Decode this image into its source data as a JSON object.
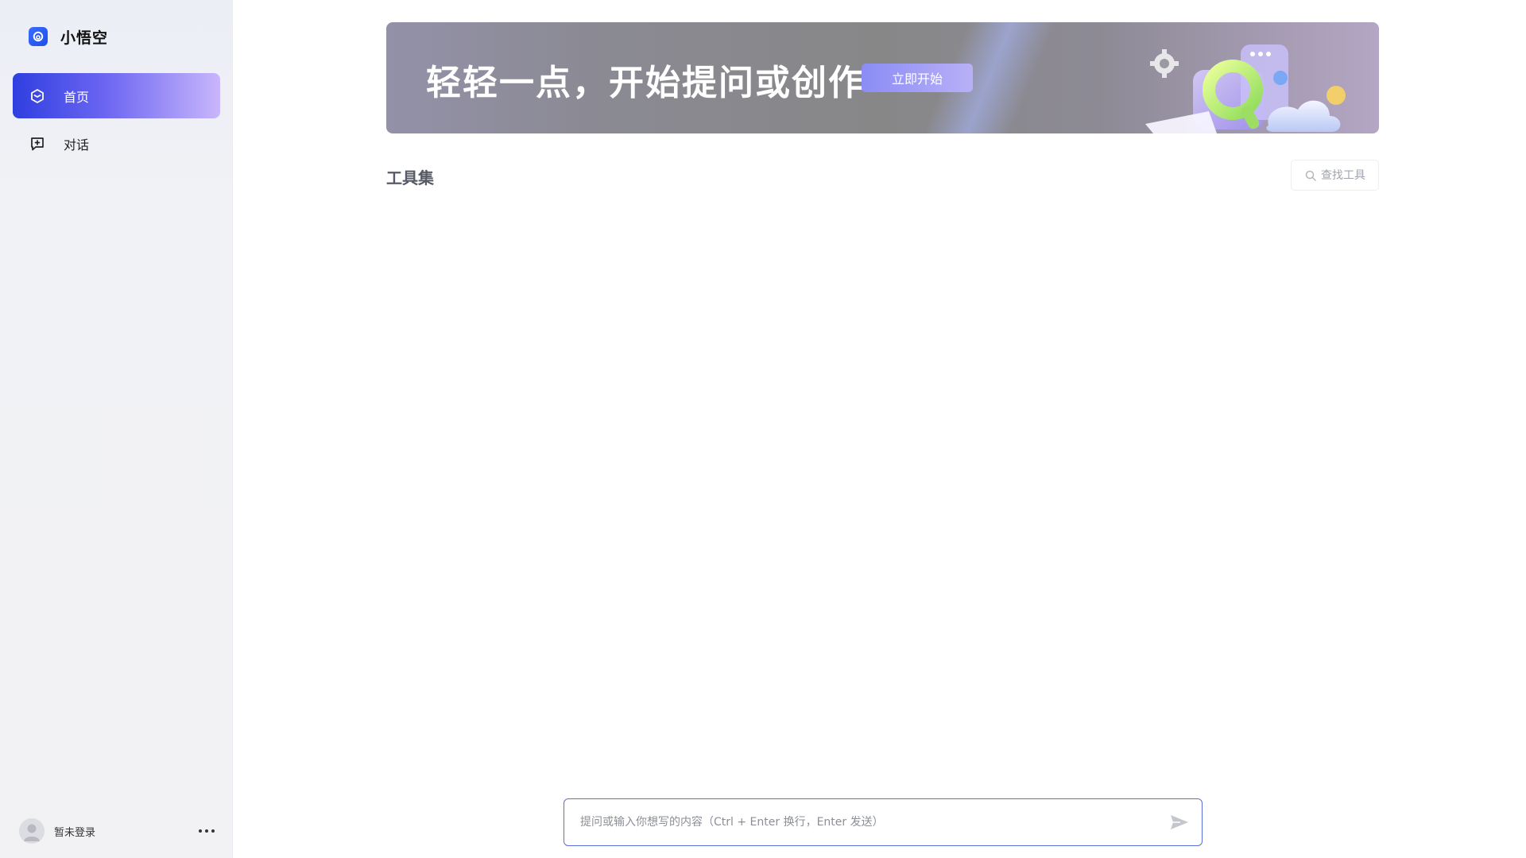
{
  "app": {
    "name": "小悟空",
    "logo_icon": "app-logo-icon",
    "accent": "#2f3fe0"
  },
  "sidebar": {
    "items": [
      {
        "label": "首页",
        "icon": "home-cube-icon",
        "active": true
      },
      {
        "label": "对话",
        "icon": "chat-plus-icon",
        "active": false
      }
    ],
    "user": {
      "name": "暂未登录",
      "avatar_icon": "user-avatar-icon",
      "more_icon": "more-dots-icon"
    }
  },
  "banner": {
    "title": "轻轻一点，开始提问或创作",
    "button_label": "立即开始"
  },
  "tools": {
    "title": "工具集",
    "search_placeholder": "查找工具",
    "search_icon": "search-icon"
  },
  "composer": {
    "placeholder": "提问或输入你想写的内容（Ctrl + Enter 换行，Enter 发送）",
    "send_icon": "send-icon"
  }
}
